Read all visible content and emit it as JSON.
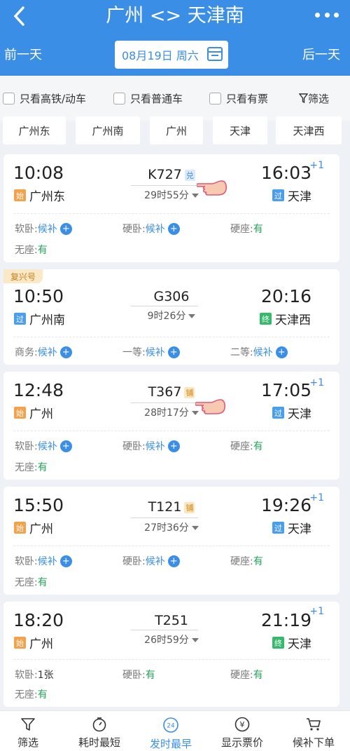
{
  "header": {
    "title": "广州 <> 天津南",
    "prev_day": "前一天",
    "next_day": "后一天",
    "date": "08月19日 周六"
  },
  "filters": {
    "high_speed": "只看高铁/动车",
    "normal": "只看普通车",
    "available": "只看有票",
    "filter": "筛选"
  },
  "stations": [
    "广州东",
    "广州南",
    "广州",
    "天津",
    "天津西"
  ],
  "trains": [
    {
      "dep_time": "10:08",
      "dep_tag": "始",
      "dep_station": "广州东",
      "train_no": "K727",
      "badge": "兑",
      "duration": "29时55分",
      "arr_time": "16:03",
      "arr_plus": "+1",
      "arr_tag": "过",
      "arr_station": "天津",
      "seats": [
        {
          "label": "软卧:",
          "value": "候补"
        },
        {
          "label": "硬卧:",
          "value": "候补"
        },
        {
          "label": "硬座:",
          "value": "有"
        },
        {
          "label": "无座:",
          "value": "有"
        }
      ]
    },
    {
      "ribbon": "复兴号",
      "dep_time": "10:50",
      "dep_tag": "过",
      "dep_station": "广州南",
      "train_no": "G306",
      "duration": "9时26分",
      "arr_time": "20:16",
      "arr_tag": "终",
      "arr_station": "天津西",
      "seats": [
        {
          "label": "商务:",
          "value": "候补"
        },
        {
          "label": "一等:",
          "value": "候补"
        },
        {
          "label": "二等:",
          "value": "候补"
        }
      ]
    },
    {
      "dep_time": "12:48",
      "dep_tag": "始",
      "dep_station": "广州",
      "train_no": "T367",
      "badge": "铺",
      "duration": "28时17分",
      "arr_time": "17:05",
      "arr_plus": "+1",
      "arr_tag": "过",
      "arr_station": "天津",
      "seats": [
        {
          "label": "软卧:",
          "value": "候补"
        },
        {
          "label": "硬卧:",
          "value": "候补"
        },
        {
          "label": "硬座:",
          "value": "有"
        },
        {
          "label": "无座:",
          "value": "有"
        }
      ]
    },
    {
      "dep_time": "15:50",
      "dep_tag": "始",
      "dep_station": "广州",
      "train_no": "T121",
      "badge": "铺",
      "duration": "27时36分",
      "arr_time": "19:26",
      "arr_plus": "+1",
      "arr_tag": "过",
      "arr_station": "天津",
      "seats": [
        {
          "label": "软卧:",
          "value": "候补"
        },
        {
          "label": "硬卧:",
          "value": "候补"
        },
        {
          "label": "硬座:",
          "value": "有"
        },
        {
          "label": "无座:",
          "value": "有"
        }
      ]
    },
    {
      "dep_time": "18:20",
      "dep_tag": "始",
      "dep_station": "广州",
      "train_no": "T251",
      "duration": "26时59分",
      "arr_time": "21:19",
      "arr_plus": "+1",
      "arr_tag": "终",
      "arr_station": "天津",
      "seats": [
        {
          "label": "软卧:",
          "value": "1张"
        },
        {
          "label": "硬卧:",
          "value": "有"
        },
        {
          "label": "硬座:",
          "value": "有"
        },
        {
          "label": "无座:",
          "value": "有"
        }
      ]
    }
  ],
  "bottom_tabs": [
    {
      "label": "筛选",
      "icon": "filter-icon"
    },
    {
      "label": "耗时最短",
      "icon": "timer-icon"
    },
    {
      "label": "发时最早",
      "icon": "clock-24-icon",
      "icon_text": "24",
      "active": true
    },
    {
      "label": "显示票价",
      "icon": "yuan-icon",
      "icon_text": "¥"
    },
    {
      "label": "候补下单",
      "icon": "cart-icon"
    }
  ],
  "colors": {
    "primary": "#3a8ee6",
    "tag_start": "#f5a14a",
    "tag_pass": "#4a9ef0",
    "tag_end": "#35b96a",
    "available": "#22a557"
  }
}
